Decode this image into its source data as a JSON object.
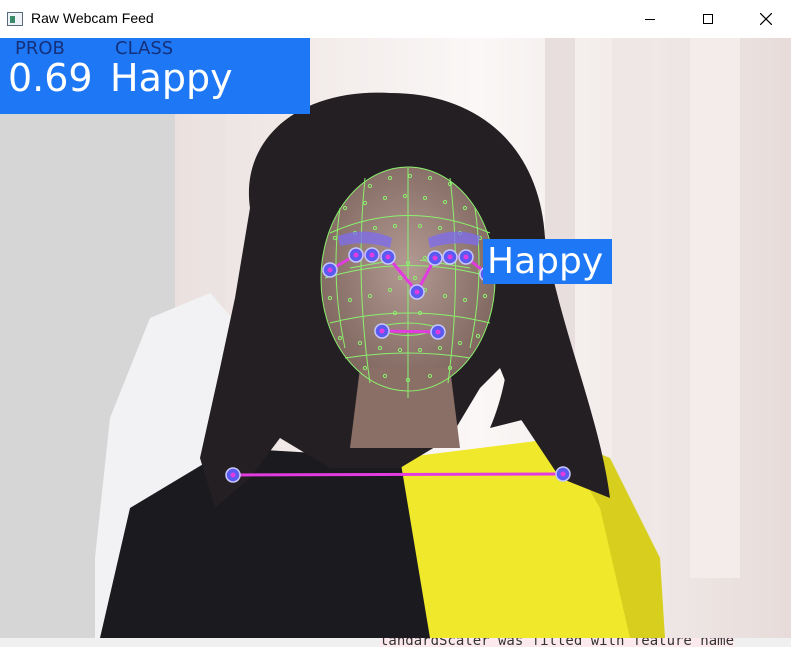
{
  "window": {
    "title": "Raw Webcam Feed",
    "controls": [
      "minimize",
      "maximize",
      "close"
    ]
  },
  "overlay": {
    "prob_label": "PROB",
    "class_label": "CLASS",
    "prob_value": "0.69",
    "class_value": "Happy",
    "face_label": "Happy",
    "banner_color": "#1e78f5",
    "landmark_color": "#8cf06e",
    "connection_color": "#e23ce0",
    "joint_color": "#5a5af0"
  },
  "console_snippet": "tandardScaler was fitted with feature name"
}
